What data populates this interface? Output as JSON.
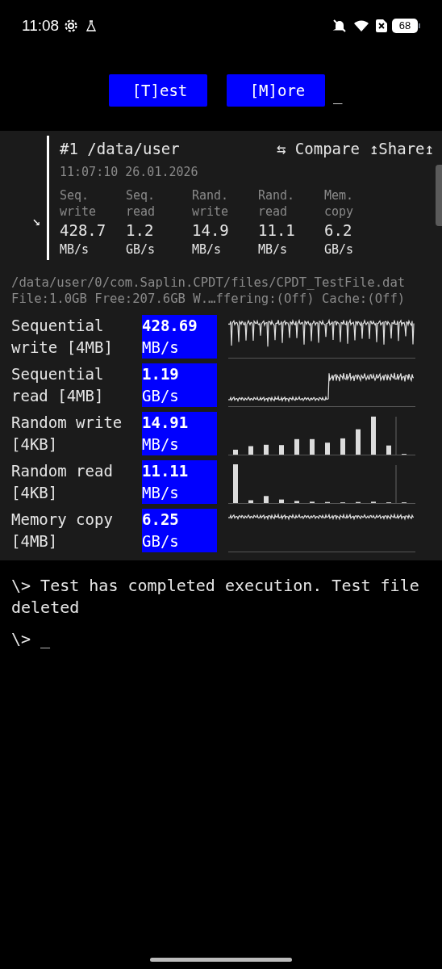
{
  "status_bar": {
    "time": "11:08",
    "battery": "68"
  },
  "toolbar": {
    "buttons": [
      "[T]est",
      "[M]ore"
    ],
    "cursor": "_"
  },
  "result": {
    "expand_glyph": "↘",
    "title": "#1 /data/user",
    "compare": "⇆ Compare",
    "share": "↥Share↥",
    "timestamp": "11:07:10 26.01.2026",
    "summary": [
      {
        "label": "Seq. write",
        "value": "428.7",
        "unit": "MB/s"
      },
      {
        "label": "Seq. read",
        "value": "1.2",
        "unit": "GB/s"
      },
      {
        "label": "Rand. write",
        "value": "14.9",
        "unit": "MB/s"
      },
      {
        "label": "Rand. read",
        "value": "11.1",
        "unit": "MB/s"
      },
      {
        "label": "Mem. copy",
        "value": "6.2",
        "unit": "GB/s"
      }
    ]
  },
  "file_info": [
    "/data/user/0/com.Saplin.CPDT/files/CPDT_TestFile.dat",
    "File:1.0GB Free:207.6GB W.…ffering:(Off) Cache:(Off)"
  ],
  "tests": [
    {
      "name": "Sequential write [4MB]",
      "value": "428.69",
      "unit": "MB/s",
      "kind": "spiky"
    },
    {
      "name": "Sequential read [4MB]",
      "value": "1.19",
      "unit": "GB/s",
      "kind": "step"
    },
    {
      "name": "Random write [4KB]",
      "value": "14.91",
      "unit": "MB/s",
      "kind": "bars"
    },
    {
      "name": "Random read [4KB]",
      "value": "11.11",
      "unit": "MB/s",
      "kind": "bars"
    },
    {
      "name": "Memory copy [4MB]",
      "value": "6.25",
      "unit": "GB/s",
      "kind": "flat"
    }
  ],
  "console": [
    "\\> Test has completed execution. Test file deleted",
    "\\> _"
  ]
}
